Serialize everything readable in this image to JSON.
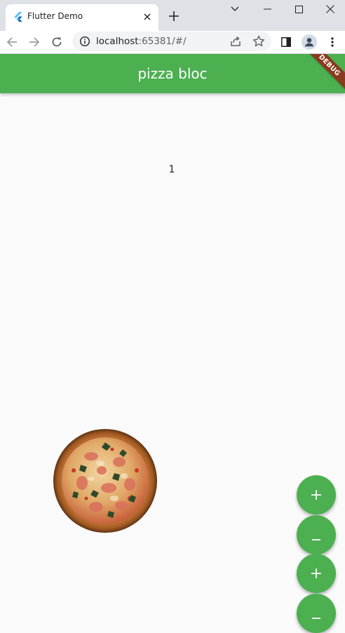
{
  "browser": {
    "tab_title": "Flutter Demo",
    "url_host": "localhost",
    "url_rest": ":65381/#/"
  },
  "app": {
    "title": "pizza bloc",
    "debug_banner": "DEBUG",
    "counter": "1",
    "primary_color": "#4caf50"
  },
  "fabs": [
    {
      "label": "+",
      "icon": "add-icon"
    },
    {
      "label": "−",
      "icon": "remove-icon"
    },
    {
      "label": "+",
      "icon": "add-icon"
    },
    {
      "label": "−",
      "icon": "remove-icon"
    }
  ]
}
